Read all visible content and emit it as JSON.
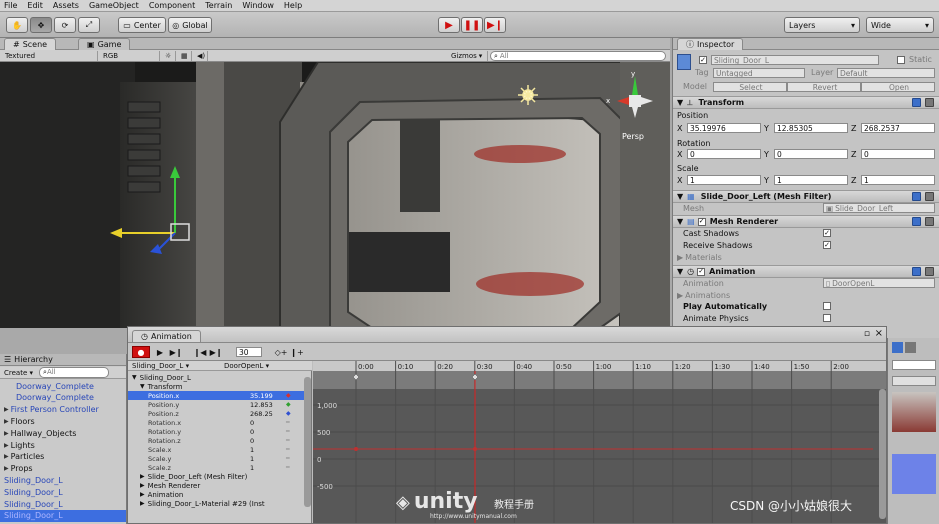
{
  "menu": [
    "File",
    "Edit",
    "Assets",
    "GameObject",
    "Component",
    "Terrain",
    "Window",
    "Help"
  ],
  "toolbar": {
    "center_label": "Center",
    "global_label": "Global",
    "layers_label": "Layers",
    "layout_label": "Wide"
  },
  "scene": {
    "tab_scene": "Scene",
    "tab_game": "Game",
    "render_mode": "Textured",
    "color_mode": "RGB",
    "gizmos_label": "Gizmos",
    "search_placeholder": "All",
    "persp_label": "Persp"
  },
  "inspector": {
    "tab_label": "Inspector",
    "object_name": "Sliding_Door_L",
    "static_label": "Static",
    "tag_label": "Tag",
    "tag_value": "Untagged",
    "layer_label": "Layer",
    "layer_value": "Default",
    "model_label": "Model",
    "model_select": "Select",
    "model_revert": "Revert",
    "model_open": "Open",
    "transform": {
      "title": "Transform",
      "position_label": "Position",
      "rotation_label": "Rotation",
      "scale_label": "Scale",
      "x": "X",
      "y": "Y",
      "z": "Z",
      "position": [
        "35.19976",
        "12.85305",
        "268.2537"
      ],
      "rotation": [
        "0",
        "0",
        "0"
      ],
      "scale": [
        "1",
        "1",
        "1"
      ]
    },
    "mesh_filter": {
      "title": "Slide_Door_Left (Mesh Filter)",
      "mesh_label": "Mesh",
      "mesh_value": "Slide_Door_Left"
    },
    "mesh_renderer": {
      "title": "Mesh Renderer",
      "cast_shadows": "Cast Shadows",
      "receive_shadows": "Receive Shadows",
      "materials": "Materials"
    },
    "animation": {
      "title": "Animation",
      "animation_label": "Animation",
      "animation_value": "DoorOpenL",
      "animations_label": "Animations",
      "play_auto": "Play Automatically",
      "animate_physics": "Animate Physics"
    }
  },
  "hierarchy": {
    "title": "Hierarchy",
    "create_label": "Create",
    "search_placeholder": "All",
    "items": [
      {
        "label": "Doorway_Complete",
        "blue": true,
        "indent": 2,
        "arrow": ""
      },
      {
        "label": "Doorway_Complete",
        "blue": true,
        "indent": 2,
        "arrow": ""
      },
      {
        "label": "First Person Controller",
        "blue": true,
        "indent": 0,
        "arrow": "▶"
      },
      {
        "label": "Floors",
        "blue": false,
        "indent": 0,
        "arrow": "▶"
      },
      {
        "label": "Hallway_Objects",
        "blue": false,
        "indent": 0,
        "arrow": "▶"
      },
      {
        "label": "Lights",
        "blue": false,
        "indent": 0,
        "arrow": "▶"
      },
      {
        "label": "Particles",
        "blue": false,
        "indent": 0,
        "arrow": "▶"
      },
      {
        "label": "Props",
        "blue": false,
        "indent": 0,
        "arrow": "▶"
      },
      {
        "label": "Sliding_Door_L",
        "blue": true,
        "indent": 0,
        "arrow": ""
      },
      {
        "label": "Sliding_Door_L",
        "blue": true,
        "indent": 0,
        "arrow": ""
      },
      {
        "label": "Sliding_Door_L",
        "blue": true,
        "indent": 0,
        "arrow": ""
      },
      {
        "label": "Sliding_Door_L",
        "blue": true,
        "indent": 0,
        "arrow": ""
      }
    ]
  },
  "animation_window": {
    "title": "Animation",
    "frame_value": "30",
    "object_name": "Sliding_Door_L",
    "clip_name": "DoorOpenL",
    "timeline_ticks": [
      "0:00",
      "0:10",
      "0:20",
      "0:30",
      "0:40",
      "0:50",
      "1:00",
      "1:10",
      "1:20",
      "1:30",
      "1:40",
      "1:50",
      "2:00"
    ],
    "y_labels": [
      "1,000",
      "500",
      "0",
      "-500"
    ],
    "tree": [
      {
        "label": "Sliding_Door_L",
        "value": "",
        "indent": 0,
        "arrow": "▼",
        "sel": false
      },
      {
        "label": "Transform",
        "value": "",
        "indent": 1,
        "arrow": "▼",
        "sel": false
      },
      {
        "label": "Position.x",
        "value": "35.199",
        "indent": 2,
        "arrow": "",
        "sel": true
      },
      {
        "label": "Position.y",
        "value": "12.853",
        "indent": 2,
        "arrow": "",
        "sel": false
      },
      {
        "label": "Position.z",
        "value": "268.25",
        "indent": 2,
        "arrow": "",
        "sel": false
      },
      {
        "label": "Rotation.x",
        "value": "0",
        "indent": 2,
        "arrow": "",
        "sel": false
      },
      {
        "label": "Rotation.y",
        "value": "0",
        "indent": 2,
        "arrow": "",
        "sel": false
      },
      {
        "label": "Rotation.z",
        "value": "0",
        "indent": 2,
        "arrow": "",
        "sel": false
      },
      {
        "label": "Scale.x",
        "value": "1",
        "indent": 2,
        "arrow": "",
        "sel": false
      },
      {
        "label": "Scale.y",
        "value": "1",
        "indent": 2,
        "arrow": "",
        "sel": false
      },
      {
        "label": "Scale.z",
        "value": "1",
        "indent": 2,
        "arrow": "",
        "sel": false
      },
      {
        "label": "Slide_Door_Left (Mesh Filter)",
        "value": "",
        "indent": 1,
        "arrow": "▶",
        "sel": false
      },
      {
        "label": "Mesh Renderer",
        "value": "",
        "indent": 1,
        "arrow": "▶",
        "sel": false
      },
      {
        "label": "Animation",
        "value": "",
        "indent": 1,
        "arrow": "▶",
        "sel": false
      },
      {
        "label": "Sliding_Door_L-Material #29 (Inst",
        "value": "",
        "indent": 1,
        "arrow": "▶",
        "sel": false
      }
    ]
  },
  "watermark": {
    "brand": "unity",
    "brand_cn": "教程手册",
    "url": "http://www.unitymanual.com",
    "csdn": "CSDN @小小姑娘很大"
  },
  "colors": {
    "accent_blue": "#3d6ee0",
    "record_red": "#d01010",
    "curve_red": "#c03030"
  }
}
